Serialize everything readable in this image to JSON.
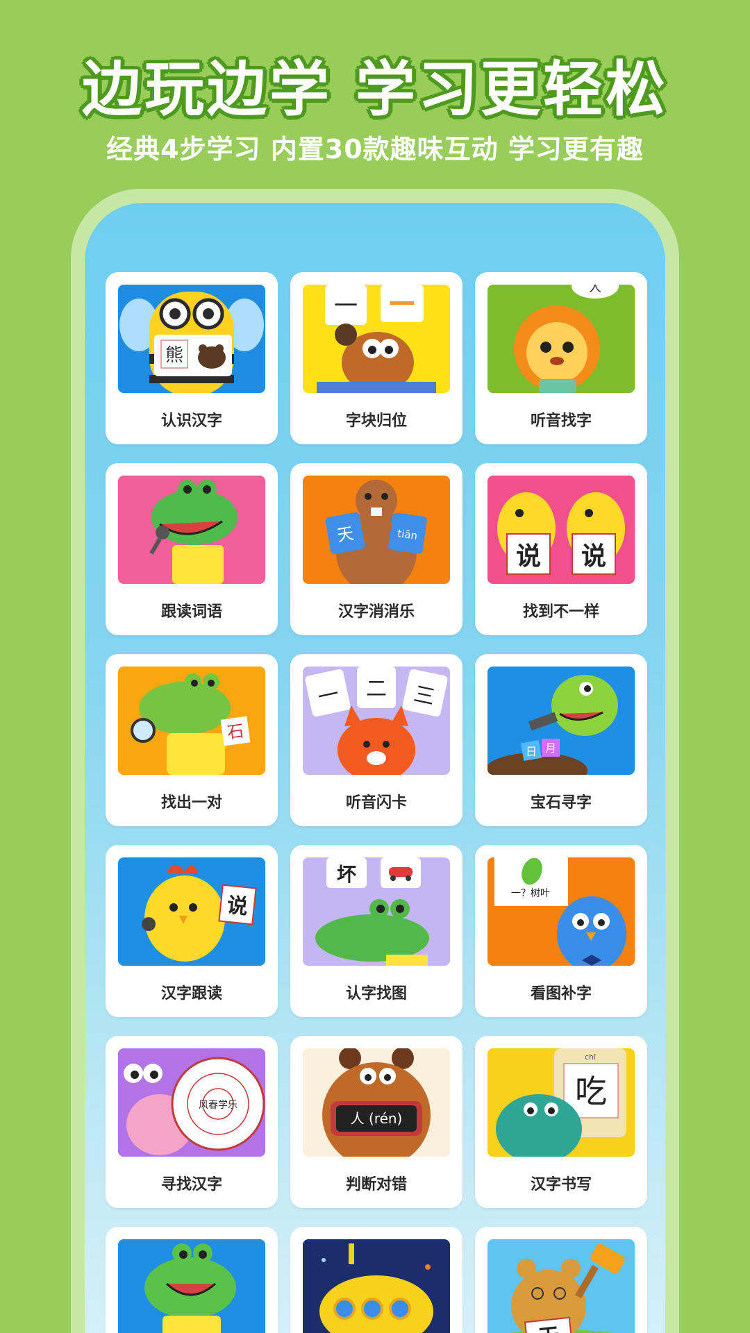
{
  "hero": {
    "title": "边玩边学 学习更轻松",
    "subtitle": "经典4步学习 内置30款趣味互动 学习更有趣"
  },
  "colors": {
    "background": "#98cd5c",
    "title_outline": "#4e9a1e",
    "phone_frame": "#c6e7a6",
    "screen_top": "#6dcff0"
  },
  "games": [
    {
      "label": "认识汉字",
      "bg": "#1f8ce3",
      "character": "bee-icon",
      "card_text": "熊"
    },
    {
      "label": "字块归位",
      "bg": "#ffe11a",
      "character": "bear-icon",
      "card_text": "一"
    },
    {
      "label": "听音找字",
      "bg": "#7dbd2d",
      "character": "lion-icon",
      "card_text": "人"
    },
    {
      "label": "跟读词语",
      "bg": "#f35f98",
      "character": "crocodile-icon",
      "card_text": ""
    },
    {
      "label": "汉字消消乐",
      "bg": "#f5820f",
      "character": "beaver-icon",
      "card_text": "天",
      "card_text_2": "tiān"
    },
    {
      "label": "找到不一样",
      "bg": "#f24f8c",
      "character": "chick-icon",
      "card_text": "说",
      "card_text_2": "说"
    },
    {
      "label": "找出一对",
      "bg": "#f8a80e",
      "character": "crocodile-icon",
      "card_text": "石"
    },
    {
      "label": "听音闪卡",
      "bg": "#c5b7f2",
      "character": "fox-icon",
      "card_text": "一",
      "card_text_2": "二",
      "card_text_3": "三"
    },
    {
      "label": "宝石寻字",
      "bg": "#1e8fe3",
      "character": "dinosaur-icon",
      "card_text": "日",
      "card_text_2": "月"
    },
    {
      "label": "汉字跟读",
      "bg": "#1e8fe3",
      "character": "chick-icon",
      "card_text": "说"
    },
    {
      "label": "认字找图",
      "bg": "#c4b7f1",
      "character": "crocodile-icon",
      "card_text": "坏"
    },
    {
      "label": "看图补字",
      "bg": "#f5820f",
      "character": "bird-icon",
      "card_text": "一？树叶"
    },
    {
      "label": "寻找汉字",
      "bg": "#b173e6",
      "character": "snail-icon",
      "card_text": "风春学乐"
    },
    {
      "label": "判断对错",
      "bg": "#fbf0dc",
      "character": "bear-icon",
      "card_text": "人 (rén)"
    },
    {
      "label": "汉字书写",
      "bg": "#f7d11a",
      "character": "dinosaur-icon",
      "card_text": "吃",
      "card_text_2": "chī"
    },
    {
      "label": "",
      "bg": "#1e8fe3",
      "character": "crocodile-icon",
      "card_text": ""
    },
    {
      "label": "",
      "bg": "#1b2e6b",
      "character": "submarine-icon",
      "card_text": ""
    },
    {
      "label": "",
      "bg": "#5fc5f0",
      "character": "bear-icon",
      "card_text": "天"
    }
  ]
}
